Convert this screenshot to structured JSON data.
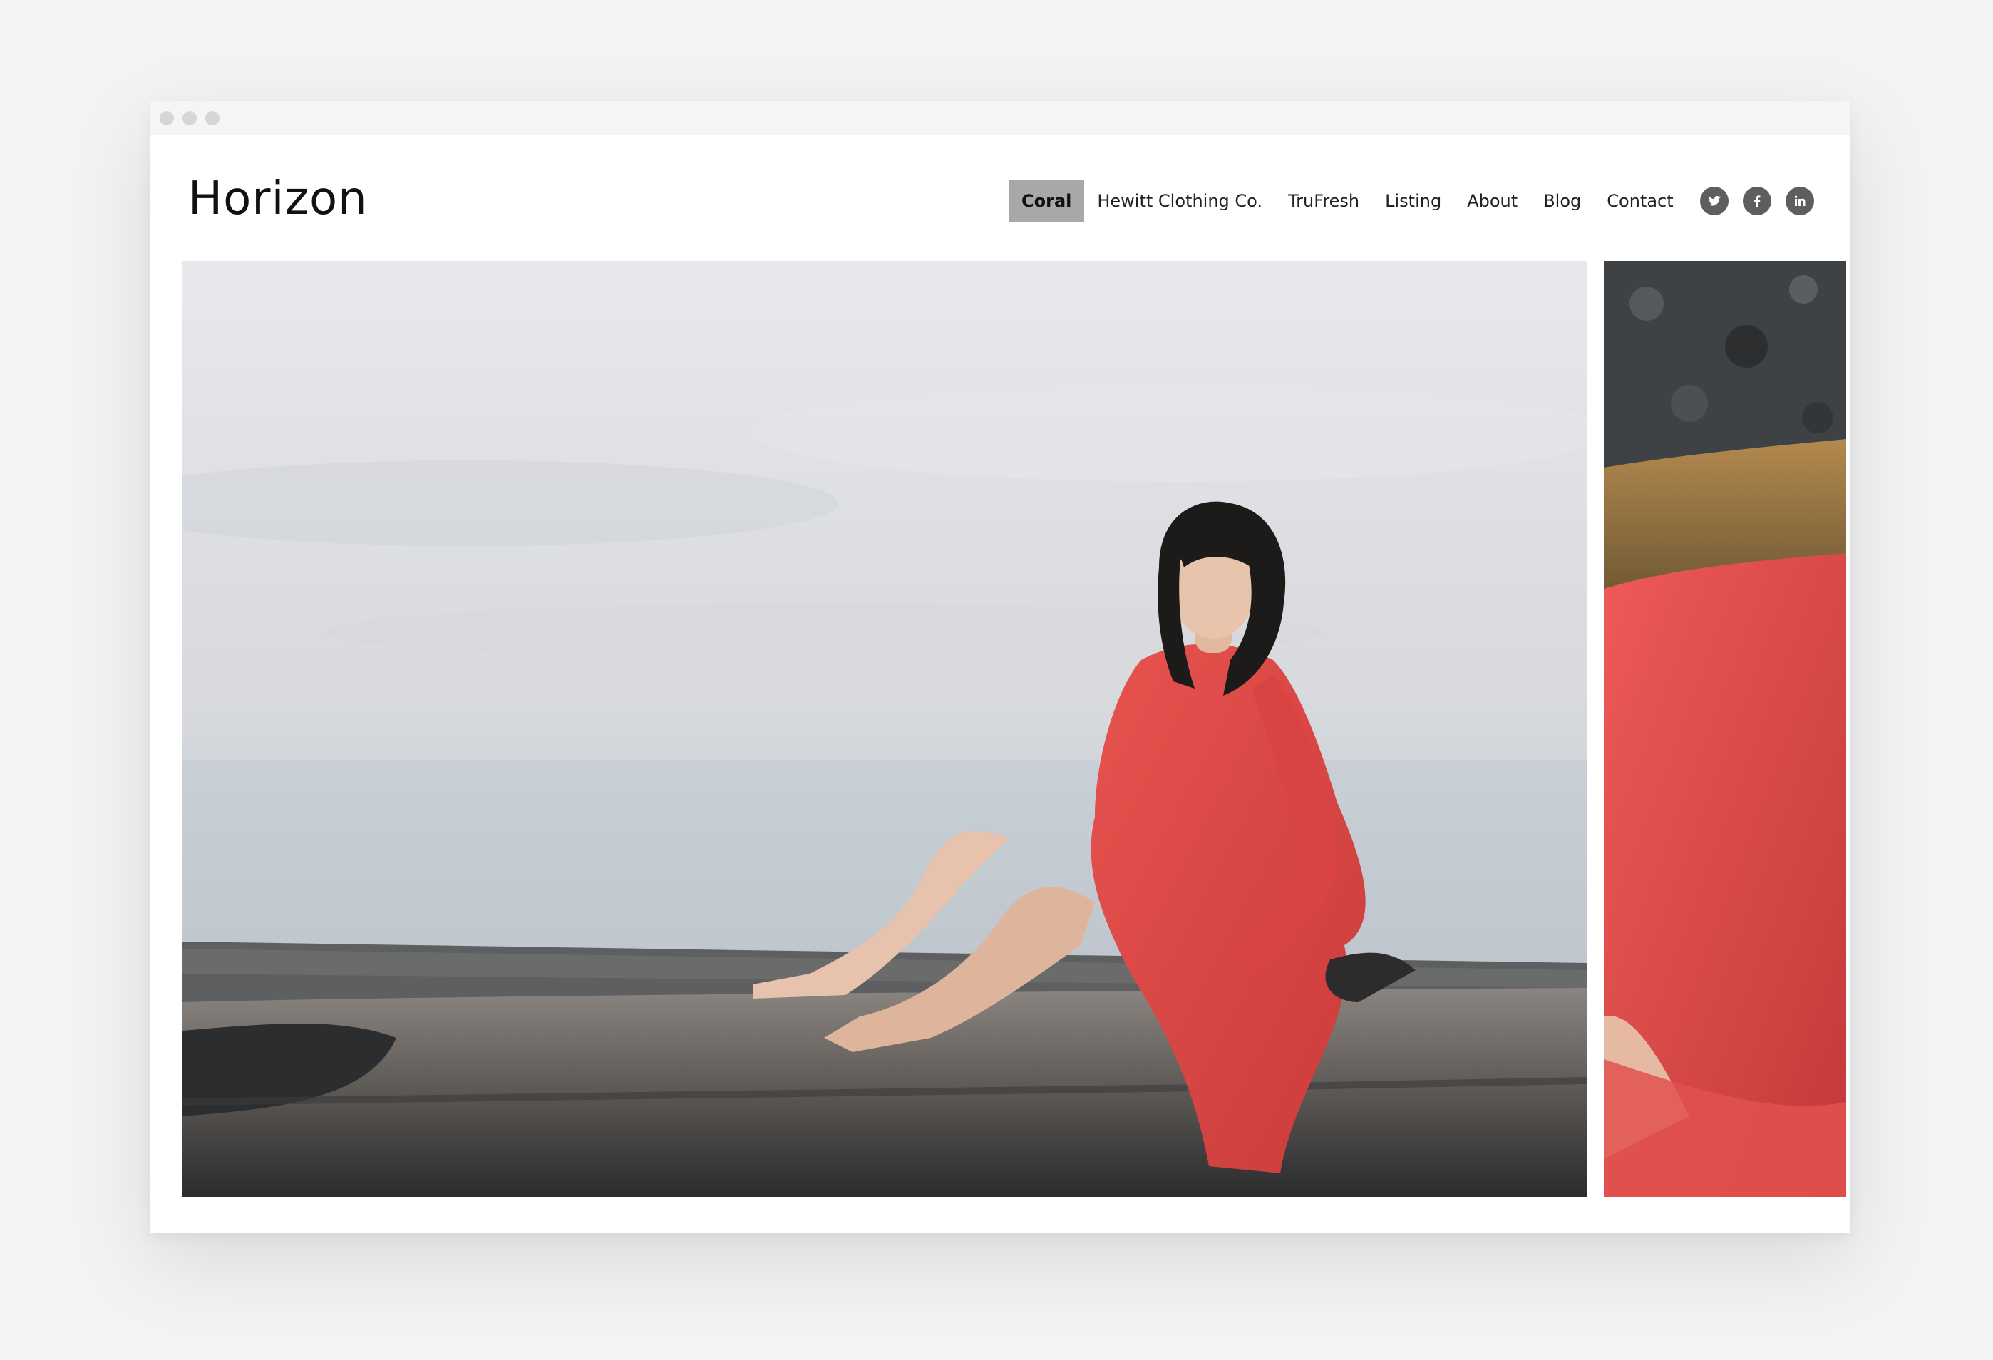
{
  "site": {
    "title": "Horizon"
  },
  "nav": {
    "items": [
      {
        "label": "Coral",
        "active": true
      },
      {
        "label": "Hewitt Clothing Co.",
        "active": false
      },
      {
        "label": "TruFresh",
        "active": false
      },
      {
        "label": "Listing",
        "active": false
      },
      {
        "label": "About",
        "active": false
      },
      {
        "label": "Blog",
        "active": false
      },
      {
        "label": "Contact",
        "active": false
      }
    ]
  },
  "social": [
    {
      "icon": "twitter-icon"
    },
    {
      "icon": "facebook-icon"
    },
    {
      "icon": "linkedin-icon"
    }
  ],
  "colors": {
    "nav_active_bg": "#a8a8a8",
    "social_icon_bg": "#5e5e5e",
    "dress": "#e0474a"
  }
}
